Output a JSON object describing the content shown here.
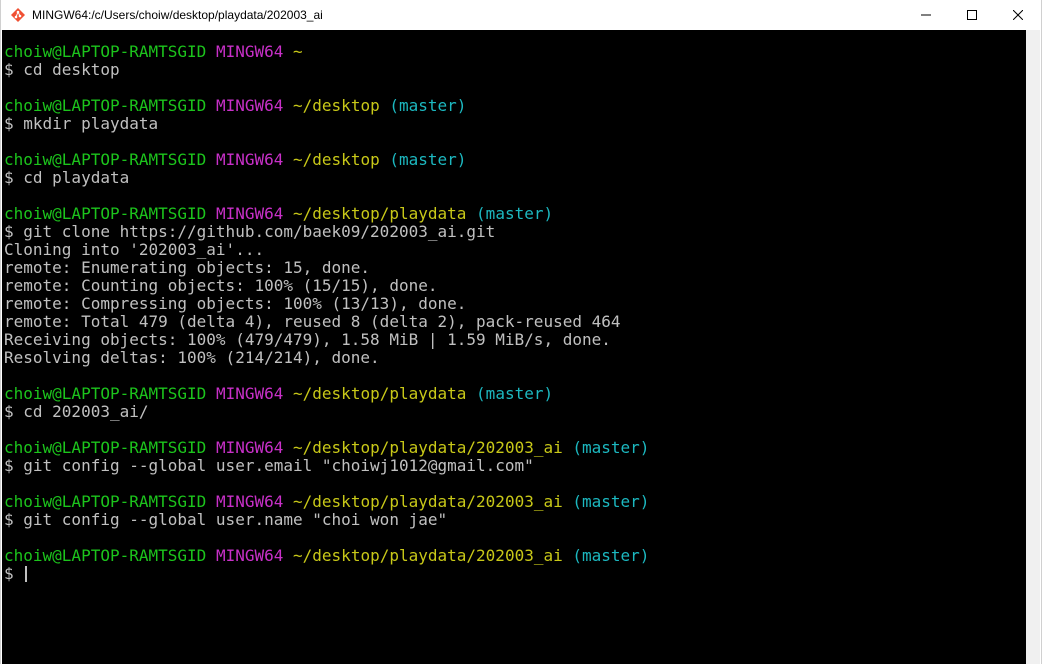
{
  "window": {
    "title": "MINGW64:/c/Users/choiw/desktop/playdata/202003_ai",
    "icon": "git-bash-icon",
    "controls": {
      "minimize": "minimize-icon",
      "maximize": "maximize-icon",
      "close": "close-icon"
    }
  },
  "colors": {
    "terminal_bg": "#000000",
    "user_host": "#1cc41c",
    "mingw": "#c830c8",
    "path": "#c8c818",
    "branch": "#1cb8c0",
    "output": "#c0c0c0"
  },
  "terminal": {
    "prompts": [
      {
        "user": "choiw@LAPTOP-RAMTSGID",
        "env": "MINGW64",
        "path": "~",
        "branch": "",
        "command": "$ cd desktop"
      },
      {
        "user": "choiw@LAPTOP-RAMTSGID",
        "env": "MINGW64",
        "path": "~/desktop",
        "branch": "(master)",
        "command": "$ mkdir playdata"
      },
      {
        "user": "choiw@LAPTOP-RAMTSGID",
        "env": "MINGW64",
        "path": "~/desktop",
        "branch": "(master)",
        "command": "$ cd playdata"
      },
      {
        "user": "choiw@LAPTOP-RAMTSGID",
        "env": "MINGW64",
        "path": "~/desktop/playdata",
        "branch": "(master)",
        "command": "$ git clone https://github.com/baek09/202003_ai.git"
      },
      {
        "user": "choiw@LAPTOP-RAMTSGID",
        "env": "MINGW64",
        "path": "~/desktop/playdata",
        "branch": "(master)",
        "command": "$ cd 202003_ai/"
      },
      {
        "user": "choiw@LAPTOP-RAMTSGID",
        "env": "MINGW64",
        "path": "~/desktop/playdata/202003_ai",
        "branch": "(master)",
        "command": "$ git config --global user.email \"choiwj1012@gmail.com\""
      },
      {
        "user": "choiw@LAPTOP-RAMTSGID",
        "env": "MINGW64",
        "path": "~/desktop/playdata/202003_ai",
        "branch": "(master)",
        "command": "$ git config --global user.name \"choi won jae\""
      },
      {
        "user": "choiw@LAPTOP-RAMTSGID",
        "env": "MINGW64",
        "path": "~/desktop/playdata/202003_ai",
        "branch": "(master)",
        "command": "$ "
      }
    ],
    "clone_output": [
      "Cloning into '202003_ai'...",
      "remote: Enumerating objects: 15, done.",
      "remote: Counting objects: 100% (15/15), done.",
      "remote: Compressing objects: 100% (13/13), done.",
      "remote: Total 479 (delta 4), reused 8 (delta 2), pack-reused 464",
      "Receiving objects: 100% (479/479), 1.58 MiB | 1.59 MiB/s, done.",
      "Resolving deltas: 100% (214/214), done."
    ]
  }
}
